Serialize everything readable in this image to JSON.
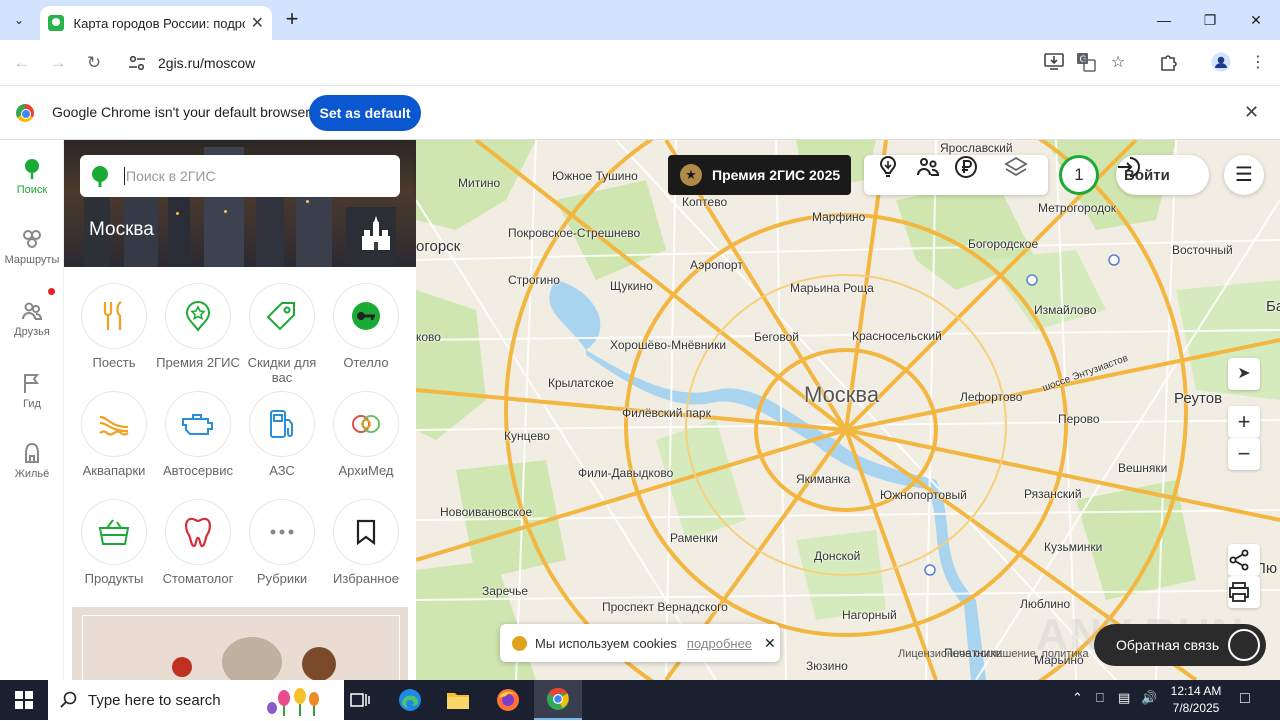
{
  "browser": {
    "tab_title": "Карта городов России: подроб",
    "url": "2gis.ru/moscow",
    "infobar_text": "Google Chrome isn't your default browser",
    "set_default_label": "Set as default"
  },
  "rail": {
    "items": [
      {
        "label": "Поиск",
        "icon": "pin-icon"
      },
      {
        "label": "Маршруты",
        "icon": "routes-icon"
      },
      {
        "label": "Друзья",
        "icon": "friends-icon"
      },
      {
        "label": "Гид",
        "icon": "flag-icon"
      },
      {
        "label": "Жильё",
        "icon": "house-icon"
      }
    ]
  },
  "panel": {
    "search_placeholder": "Поиск в 2ГИС",
    "city": "Москва",
    "categories": [
      {
        "label": "Поесть",
        "icon": "fork-knife-icon"
      },
      {
        "label": "Премия 2ГИС",
        "icon": "award-icon"
      },
      {
        "label": "Скидки для вас",
        "icon": "tag-icon"
      },
      {
        "label": "Отелло",
        "icon": "key-icon"
      },
      {
        "label": "Аквапарки",
        "icon": "water-slide-icon"
      },
      {
        "label": "Автосервис",
        "icon": "engine-icon"
      },
      {
        "label": "АЗС",
        "icon": "fuel-icon"
      },
      {
        "label": "АрхиМед",
        "icon": "archimed-icon"
      },
      {
        "label": "Продукты",
        "icon": "basket-icon"
      },
      {
        "label": "Стоматолог",
        "icon": "tooth-icon"
      },
      {
        "label": "Рубрики",
        "icon": "more-icon"
      },
      {
        "label": "Избранное",
        "icon": "bookmark-icon"
      }
    ]
  },
  "map": {
    "premium_label": "Премия 2ГИС 2025",
    "counter": "1",
    "login_label": "Войти",
    "cookie_text": "Мы используем cookies",
    "cookie_link": "подробнее",
    "feedback_label": "Обратная связь",
    "watermark": "ANY.RUN",
    "copyright": "Лицензионное соглашение, политика",
    "labels": [
      {
        "text": "Москва",
        "size": "big"
      },
      {
        "text": "Реутов",
        "size": "mid"
      },
      {
        "text": "огорск",
        "size": "mid"
      },
      {
        "text": "Ярославский"
      },
      {
        "text": "Южное Тушино"
      },
      {
        "text": "Митино"
      },
      {
        "text": "Коптево"
      },
      {
        "text": "Марфино"
      },
      {
        "text": "Метрогородок"
      },
      {
        "text": "Покровское-Стрешнево"
      },
      {
        "text": "Богородское"
      },
      {
        "text": "Аэропорт"
      },
      {
        "text": "Восточный"
      },
      {
        "text": "Строгино"
      },
      {
        "text": "Марьина Роща"
      },
      {
        "text": "Щукино"
      },
      {
        "text": "Измайлово"
      },
      {
        "text": "Беговой"
      },
      {
        "text": "Красносельский"
      },
      {
        "text": "ково"
      },
      {
        "text": "Хорошёво-Мнёвники"
      },
      {
        "text": "Крылатское"
      },
      {
        "text": "Лефортово"
      },
      {
        "text": "Филёвский парк"
      },
      {
        "text": "Перово"
      },
      {
        "text": "Кунцево"
      },
      {
        "text": "Фили-Давыдково"
      },
      {
        "text": "Якиманка"
      },
      {
        "text": "Южнопортовый"
      },
      {
        "text": "Рязанский"
      },
      {
        "text": "Вешняки"
      },
      {
        "text": "Новоивановское"
      },
      {
        "text": "Раменки"
      },
      {
        "text": "Донской"
      },
      {
        "text": "Кузьминки"
      },
      {
        "text": "Заречье"
      },
      {
        "text": "Проспект Вернадского"
      },
      {
        "text": "Нагорный"
      },
      {
        "text": "Люблино"
      },
      {
        "text": "Зюзино"
      },
      {
        "text": "Печатники"
      },
      {
        "text": "Марьино"
      },
      {
        "text": "Лю"
      },
      {
        "text": "Ба"
      },
      {
        "text": "шоссе Энтузиастов"
      }
    ]
  },
  "taskbar": {
    "search_placeholder": "Type here to search",
    "time": "12:14 AM",
    "date": "7/8/2025"
  },
  "colors": {
    "brand_green": "#1baa35",
    "chrome_blue": "#0b57d0",
    "tab_strip": "#d3e3fd"
  }
}
